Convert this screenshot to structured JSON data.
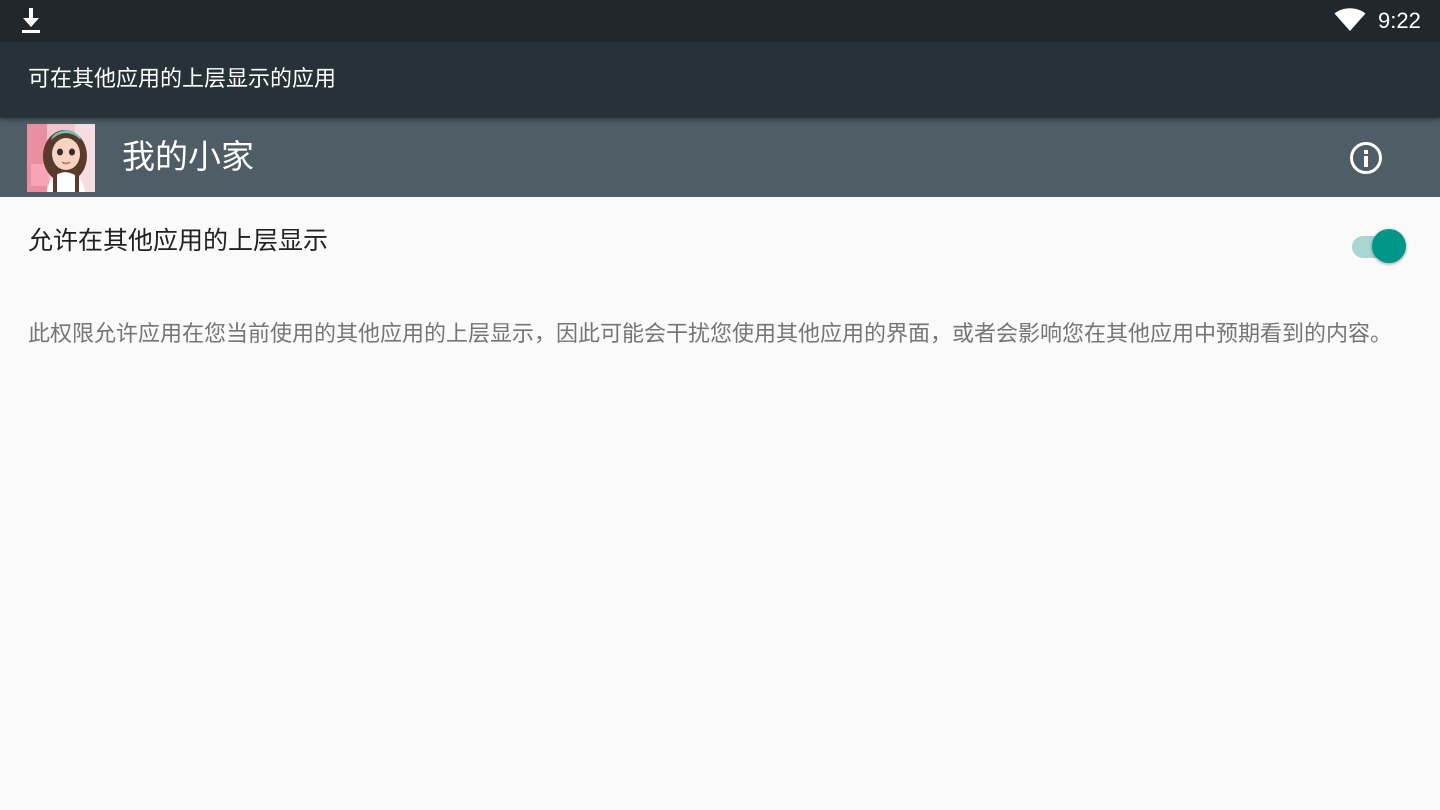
{
  "status_bar": {
    "time": "9:22",
    "left_icon": "download-icon",
    "right_icon": "wifi-icon"
  },
  "app_bar": {
    "title": "可在其他应用的上层显示的应用"
  },
  "app_header": {
    "app_name": "我的小家",
    "app_icon": "app-icon",
    "info_icon": "info-icon"
  },
  "permission": {
    "title": "允许在其他应用的上层显示",
    "enabled": true,
    "summary": "此权限允许应用在您当前使用的其他应用的上层显示，因此可能会干扰您使用其他应用的界面，或者会影响您在其他应用中预期看到的内容。"
  },
  "colors": {
    "status_bar": "#21272b",
    "app_bar": "#263238",
    "app_header": "#4f5d66",
    "background": "#fafafa",
    "switch_thumb": "#009688",
    "switch_track": "#a9d6d3"
  }
}
